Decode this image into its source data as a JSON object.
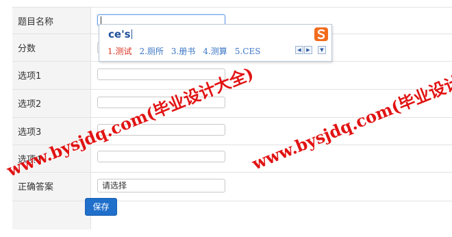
{
  "form": {
    "rows": [
      {
        "label": "题目名称",
        "value": ""
      },
      {
        "label": "分数",
        "value": ""
      },
      {
        "label": "选项1",
        "value": ""
      },
      {
        "label": "选项2",
        "value": ""
      },
      {
        "label": "选项3",
        "value": ""
      },
      {
        "label": "选项4",
        "value": ""
      },
      {
        "label": "正确答案",
        "value": "请选择"
      }
    ],
    "save_label": "保存"
  },
  "ime": {
    "composition": "ce's",
    "candidates": [
      "1.测试",
      "2.厕所",
      "3.册书",
      "4.测算",
      "5.CES"
    ],
    "selected_index": 0
  },
  "watermark": {
    "text1": "www.bysjdq.com(毕业设计大全)",
    "text2": "www.bysjdq.com(毕业设计大全)"
  },
  "colors": {
    "accent": "#1f6fcb",
    "watermark": "#e00000",
    "label_bg": "#f4f4f4"
  }
}
